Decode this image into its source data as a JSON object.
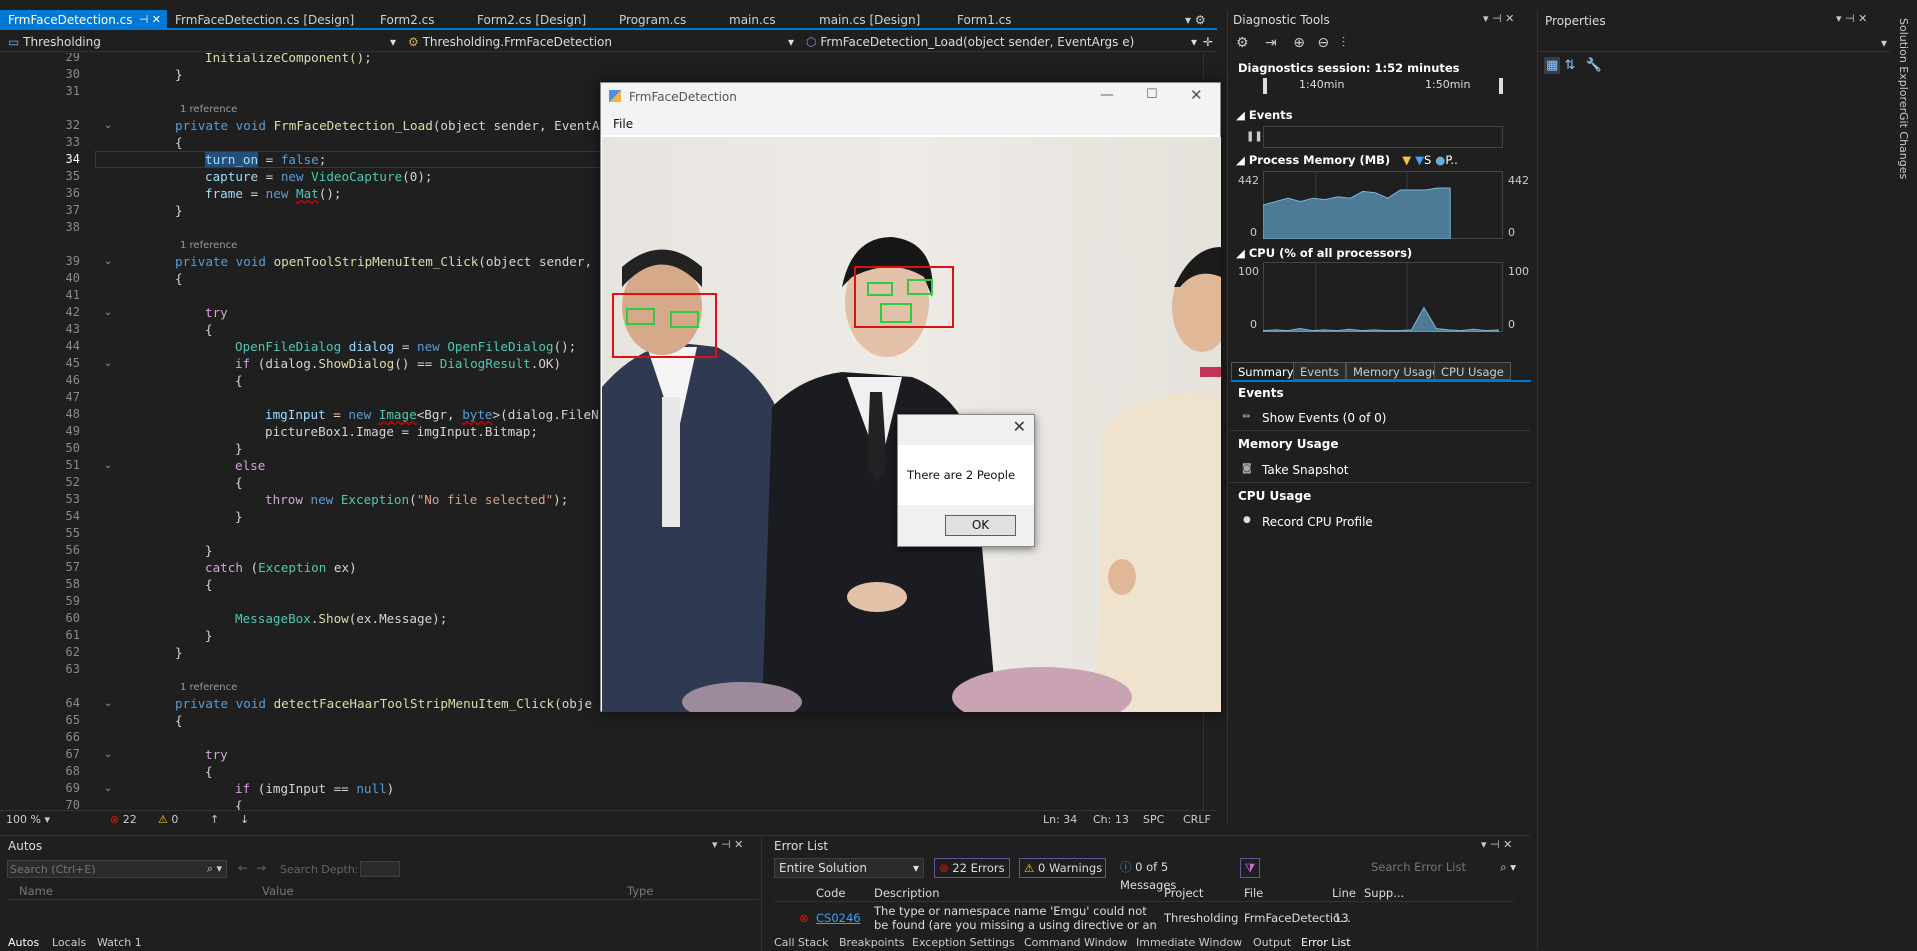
{
  "tabs": [
    {
      "label": "FrmFaceDetection.cs",
      "active": true
    },
    {
      "label": "FrmFaceDetection.cs [Design]"
    },
    {
      "label": "Form2.cs"
    },
    {
      "label": "Form2.cs [Design]"
    },
    {
      "label": "Program.cs"
    },
    {
      "label": "main.cs"
    },
    {
      "label": "main.cs [Design]"
    },
    {
      "label": "Form1.cs"
    }
  ],
  "nav": {
    "project": "Thresholding",
    "class": "Thresholding.FrmFaceDetection",
    "member": "FrmFaceDetection_Load(object sender, EventArgs e)"
  },
  "code": {
    "line_numbers": [
      "29",
      "30",
      "31",
      "32",
      "33",
      "34",
      "35",
      "36",
      "37",
      "38",
      "39",
      "40",
      "41",
      "42",
      "43",
      "44",
      "45",
      "46",
      "47",
      "48",
      "49",
      "50",
      "51",
      "52",
      "53",
      "54",
      "55",
      "56",
      "57",
      "58",
      "59",
      "60",
      "61",
      "62",
      "63",
      "64",
      "65",
      "66",
      "67",
      "68",
      "69",
      "70"
    ],
    "reference_label": "1 reference",
    "lines": {
      "l29": "InitializeComponent();",
      "l30": "}",
      "l32a": "private void ",
      "l32b": "FrmFaceDetection_Load",
      "l32c": "(object sender, EventA",
      "l33": "{",
      "l34a": "turn_on",
      "l34b": " = ",
      "l34c": "false",
      "l34d": ";",
      "l35a": "capture",
      "l35b": " = ",
      "l35c": "new ",
      "l35d": "VideoCapture",
      "l35e": "(0);",
      "l36a": "frame",
      "l36b": " = ",
      "l36c": "new ",
      "l36d": "Mat",
      "l36e": "();",
      "l37": "}",
      "l39a": "private void ",
      "l39b": "openToolStripMenuItem_Click",
      "l39c": "(object sender,",
      "l40": "{",
      "l42": "try",
      "l43": "{",
      "l44a": "OpenFileDialog",
      "l44b": " dialog",
      "l44c": " = ",
      "l44d": "new ",
      "l44e": "OpenFileDialog",
      "l44f": "();",
      "l45a": "if",
      "l45b": " (dialog.",
      "l45c": "ShowDialog",
      "l45d": "() == ",
      "l45e": "DialogResult",
      "l45f": ".OK)",
      "l46": "{",
      "l48a": "imgInput",
      "l48b": " = ",
      "l48c": "new ",
      "l48d": "Image",
      "l48e": "<Bgr, ",
      "l48f": "byte",
      "l48g": ">(dialog.FileN",
      "l49": "pictureBox1.Image = imgInput.Bitmap;",
      "l50": "}",
      "l51": "else",
      "l52": "{",
      "l53a": "throw ",
      "l53b": "new ",
      "l53c": "Exception",
      "l53d": "(",
      "l53e": "\"No file selected\"",
      "l53f": ");",
      "l54": "}",
      "l56": "}",
      "l57a": "catch",
      "l57b": " (",
      "l57c": "Exception",
      "l57d": " ex)",
      "l58": "{",
      "l60a": "MessageBox",
      "l60b": ".",
      "l60c": "Show",
      "l60d": "(ex.Message);",
      "l61": "}",
      "l62": "}",
      "l64a": "private void ",
      "l64b": "detectFaceHaarToolStripMenuItem_Click",
      "l64c": "(obje",
      "l65": "{",
      "l67": "try",
      "l68": "{",
      "l69a": "if",
      "l69b": " (imgInput == ",
      "l69c": "null",
      "l69d": ")",
      "l70": "{"
    }
  },
  "status": {
    "zoom": "100 %",
    "errors": "22",
    "warnings": "0",
    "ln": "Ln: 34",
    "ch": "Ch: 13",
    "spc": "SPC",
    "crlf": "CRLF"
  },
  "form": {
    "title": "FrmFaceDetection",
    "menu_file": "File"
  },
  "messagebox": {
    "text": "There are 2 People",
    "ok": "OK"
  },
  "diagnostics": {
    "title": "Diagnostic Tools",
    "session": "Diagnostics session: 1:52 minutes",
    "t1": "1:40min",
    "t2": "1:50min",
    "events_label": "Events",
    "memory_label": "Process Memory (MB)",
    "memory_legend": [
      "S",
      "P.."
    ],
    "memory_max": "442",
    "memory_min": "0",
    "cpu_label": "CPU (% of all processors)",
    "cpu_max": "100",
    "cpu_min": "0",
    "tabs": [
      "Summary",
      "Events",
      "Memory Usage",
      "CPU Usage"
    ],
    "sections": {
      "events": "Events",
      "show_events": "Show Events (0 of 0)",
      "memory": "Memory Usage",
      "snapshot": "Take Snapshot",
      "cpu": "CPU Usage",
      "record": "Record CPU Profile"
    },
    "memory_series": [
      0.5,
      0.55,
      0.6,
      0.55,
      0.6,
      0.58,
      0.62,
      0.6,
      0.7,
      0.68,
      0.6,
      0.72,
      0.72,
      0.72,
      0.75,
      0.75
    ],
    "cpu_series": [
      0.02,
      0.03,
      0.02,
      0.05,
      0.02,
      0.03,
      0.02,
      0.04,
      0.02,
      0.03,
      0.02,
      0.02,
      0.03,
      0.35,
      0.05,
      0.03,
      0.02,
      0.04,
      0.02,
      0.03
    ]
  },
  "properties": {
    "title": "Properties"
  },
  "right_strip": {
    "solution_explorer": "Solution Explorer",
    "git_changes": "Git Changes"
  },
  "autos": {
    "title": "Autos",
    "search_placeholder": "Search (Ctrl+E)",
    "search_depth": "Search Depth:",
    "columns": [
      "Name",
      "Value",
      "Type"
    ],
    "bottom_tabs": [
      "Autos",
      "Locals",
      "Watch 1"
    ]
  },
  "errorlist": {
    "title": "Error List",
    "scope": "Entire Solution",
    "errors_btn": "22 Errors",
    "warnings_btn": "0 Warnings",
    "messages_btn": "0 of 5 Messages",
    "search_placeholder": "Search Error List",
    "columns": [
      "Code",
      "Description",
      "Project",
      "File",
      "Line",
      "Supp..."
    ],
    "row": {
      "code": "CS0246",
      "description": "The type or namespace name 'Emgu' could not be found (are you missing a using directive or an assembly reference?)",
      "project": "Thresholding",
      "file": "FrmFaceDetectio...",
      "line": "13"
    },
    "bottom_tabs": [
      "Call Stack",
      "Breakpoints",
      "Exception Settings",
      "Command Window",
      "Immediate Window",
      "Output",
      "Error List"
    ]
  }
}
